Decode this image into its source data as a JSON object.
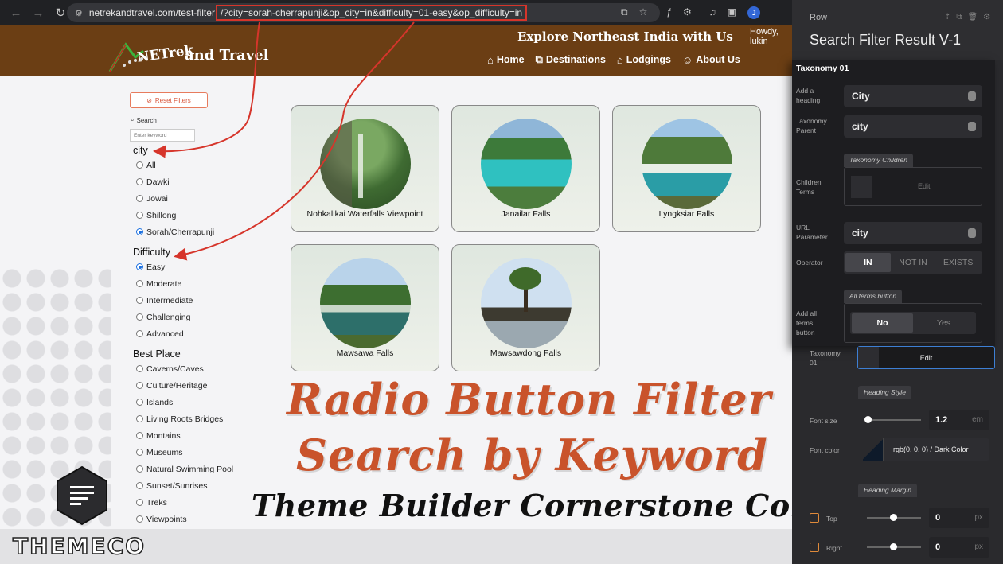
{
  "browser": {
    "url_host": "netrekandtravel.com/test-filter",
    "url_query": "/?city=sorah-cherrapunji&op_city=in&difficulty=01-easy&op_difficulty=in",
    "profile_initial": "J"
  },
  "site": {
    "logo_top": "NETrek",
    "logo_bottom": "and Travel",
    "tagline": "Explore Northeast India with Us",
    "howdy": "Howdy, lukin",
    "nav": [
      {
        "label": "Home",
        "icon": "home-icon"
      },
      {
        "label": "Destinations",
        "icon": "map-icon"
      },
      {
        "label": "Lodgings",
        "icon": "house-icon"
      },
      {
        "label": "About Us",
        "icon": "users-icon"
      }
    ]
  },
  "filters": {
    "reset_label": "Reset Filters",
    "search_label": "Search",
    "search_placeholder": "Enter keyword",
    "groups": [
      {
        "title": "city",
        "options": [
          "All",
          "Dawki",
          "Jowai",
          "Shillong",
          "Sorah/Cherrapunji"
        ],
        "selected": 4
      },
      {
        "title": "Difficulty",
        "options": [
          "Easy",
          "Moderate",
          "Intermediate",
          "Challenging",
          "Advanced"
        ],
        "selected": 0
      },
      {
        "title": "Best Place",
        "options": [
          "Caverns/Caves",
          "Culture/Heritage",
          "Islands",
          "Living Roots Bridges",
          "Montains",
          "Museums",
          "Natural Swimming Pool",
          "Sunset/Sunrises",
          "Treks",
          "Viewpoints"
        ],
        "selected": -1
      }
    ]
  },
  "results": [
    {
      "title": "Nohkalikai Waterfalls Viewpoint"
    },
    {
      "title": "Janailar Falls"
    },
    {
      "title": "Lyngksiar Falls"
    },
    {
      "title": "Mawsawa Falls"
    },
    {
      "title": "Mawsawdong Falls"
    }
  ],
  "overlay": {
    "headline_1": "Radio Button Filter",
    "headline_2": "Search by Keyword",
    "subheadline": "Theme Builder Cornerstone Component",
    "brand": "THEMECO"
  },
  "panel": {
    "row_label": "Row",
    "title": "Search Filter Result V-1",
    "section": "Taxonomy 01",
    "add_heading_label": "Add a heading",
    "heading_value": "City",
    "taxonomy_parent_label": "Taxonomy Parent",
    "taxonomy_parent_value": "city",
    "taxonomy_children_tab": "Taxonomy Children",
    "children_terms_label": "Children Terms",
    "children_edit": "Edit",
    "url_param_label": "URL Parameter",
    "url_param_value": "city",
    "operator_label": "Operator",
    "operator_options": [
      "IN",
      "NOT IN",
      "EXISTS"
    ],
    "all_terms_tab": "All terms button",
    "add_all_terms_label": "Add all terms button",
    "all_terms_options": [
      "No",
      "Yes"
    ],
    "taxonomy01_label": "Taxonomy 01",
    "taxonomy01_edit": "Edit",
    "heading_style_tab": "Heading Style",
    "font_size_label": "Font size",
    "font_size_value": "1.2",
    "font_size_unit": "em",
    "font_color_label": "Font color",
    "font_color_value": "rgb(0, 0, 0) / Dark Color",
    "heading_margin_tab": "Heading Margin",
    "top_label": "Top",
    "top_value": "0",
    "right_label": "Right",
    "right_value": "0",
    "px_unit": "px"
  }
}
